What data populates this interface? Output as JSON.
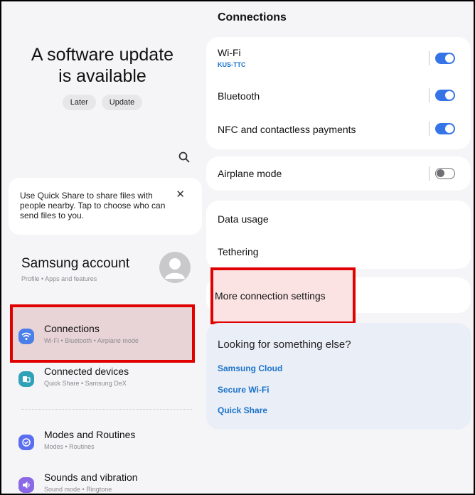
{
  "left_panel": {
    "update_banner": {
      "title_line1": "A software update",
      "title_line2": "is available",
      "later_label": "Later",
      "update_label": "Update"
    },
    "quick_share_tip": {
      "text": "Use Quick Share to share files with people nearby. Tap to choose who can send files to you.",
      "close_glyph": "✕"
    },
    "account": {
      "title": "Samsung account",
      "subtitle": "Profile • Apps and features"
    },
    "menu": [
      {
        "title": "Connections",
        "subtitle": "Wi-Fi • Bluetooth • Airplane mode",
        "icon": "wifi-icon",
        "color": "#4a7ee8"
      },
      {
        "title": "Connected devices",
        "subtitle": "Quick Share • Samsung DeX",
        "icon": "connected-devices-icon",
        "color": "#2fa2b8"
      },
      {
        "title": "Modes and Routines",
        "subtitle": "Modes • Routines",
        "icon": "check-circle-icon",
        "color": "#5b6ef0"
      },
      {
        "title": "Sounds and vibration",
        "subtitle": "Sound mode • Ringtone",
        "icon": "speaker-icon",
        "color": "#8a68e6"
      }
    ]
  },
  "right_panel": {
    "header": "Connections",
    "wifi": {
      "label": "Wi-Fi",
      "network": "KUS-TTC",
      "on": true
    },
    "bluetooth": {
      "label": "Bluetooth",
      "on": true
    },
    "nfc": {
      "label": "NFC and contactless payments",
      "on": true
    },
    "airplane": {
      "label": "Airplane mode",
      "on": false
    },
    "data_usage": "Data usage",
    "tethering": "Tethering",
    "more_settings": "More connection settings",
    "looking": {
      "title": "Looking for something else?",
      "links": [
        "Samsung Cloud",
        "Secure Wi-Fi",
        "Quick Share"
      ]
    }
  },
  "colors": {
    "accent_blue": "#3574e6",
    "link_blue": "#1a73c9",
    "highlight_red": "#e00000"
  }
}
